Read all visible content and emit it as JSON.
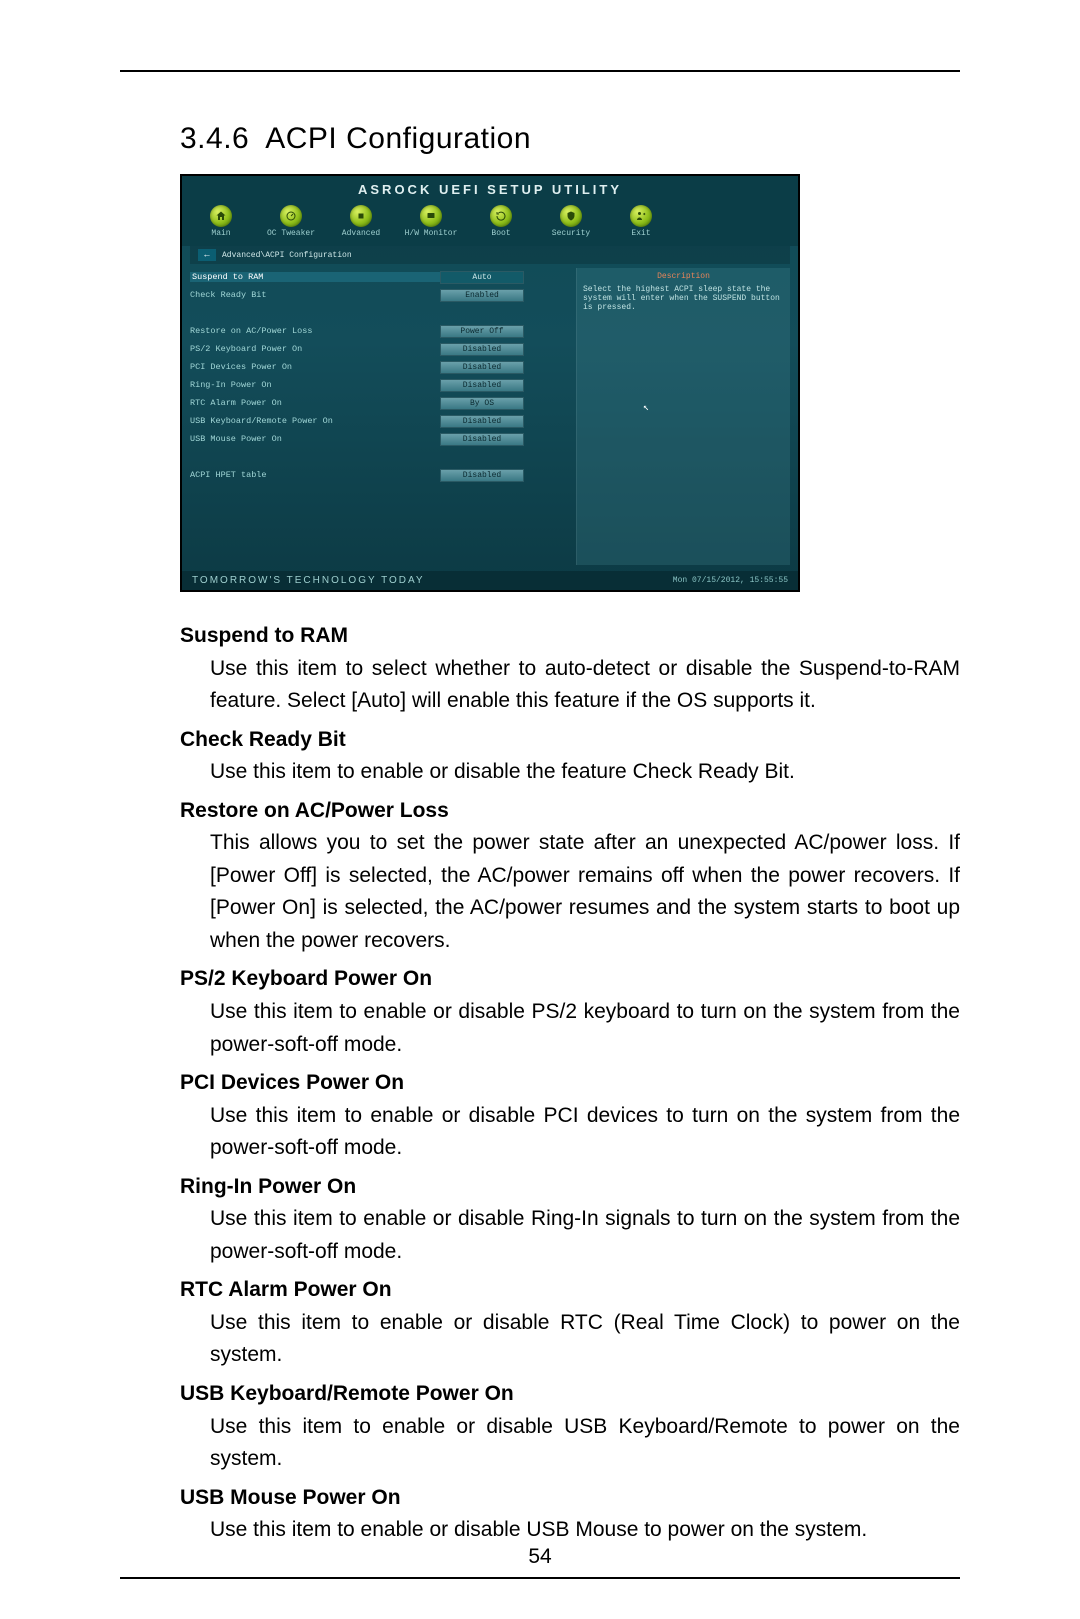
{
  "page_number": "54",
  "section": {
    "number": "3.4.6",
    "title": "ACPI Configuration"
  },
  "bios": {
    "window_title": "ASROCK UEFI SETUP UTILITY",
    "tabs": [
      {
        "id": "main",
        "label": "Main"
      },
      {
        "id": "oc",
        "label": "OC Tweaker"
      },
      {
        "id": "adv",
        "label": "Advanced"
      },
      {
        "id": "hw",
        "label": "H/W Monitor"
      },
      {
        "id": "boot",
        "label": "Boot"
      },
      {
        "id": "sec",
        "label": "Security"
      },
      {
        "id": "exit",
        "label": "Exit"
      }
    ],
    "breadcrumb": "Advanced\\ACPI Configuration",
    "options": [
      {
        "label": "Suspend to RAM",
        "value": "Auto",
        "selected": true
      },
      {
        "label": "Check Ready Bit",
        "value": "Enabled"
      },
      {
        "label": "",
        "value": ""
      },
      {
        "label": "Restore on AC/Power Loss",
        "value": "Power Off"
      },
      {
        "label": "PS/2 Keyboard Power On",
        "value": "Disabled"
      },
      {
        "label": "PCI Devices Power On",
        "value": "Disabled"
      },
      {
        "label": "Ring-In Power On",
        "value": "Disabled"
      },
      {
        "label": "RTC Alarm Power On",
        "value": "By OS"
      },
      {
        "label": "USB Keyboard/Remote Power On",
        "value": "Disabled"
      },
      {
        "label": "USB Mouse Power On",
        "value": "Disabled"
      },
      {
        "label": "",
        "value": ""
      },
      {
        "label": "ACPI HPET table",
        "value": "Disabled"
      }
    ],
    "help_header": "Description",
    "help_text": "Select the highest ACPI sleep state the system will enter when the SUSPEND button is pressed.",
    "footer_slogan": "TOMORROW'S TECHNOLOGY TODAY",
    "footer_datetime": "Mon 07/15/2012, 15:55:55"
  },
  "entries": [
    {
      "title": "Suspend to RAM",
      "body": "Use this item to select whether to auto-detect or disable the Suspend-to-RAM feature. Select [Auto] will enable this feature if the OS supports it."
    },
    {
      "title": "Check Ready Bit",
      "body": "Use this item to enable or disable the feature Check Ready Bit."
    },
    {
      "title": "Restore on AC/Power Loss",
      "body": "This allows you to set the power state after an unexpected AC/power loss. If [Power Off] is selected, the AC/power remains off when the power recovers. If [Power On] is selected, the AC/power resumes and the system starts to boot up when the power recovers."
    },
    {
      "title": "PS/2 Keyboard Power On",
      "body": "Use this item to enable or disable PS/2 keyboard to turn on the system from the power-soft-off mode."
    },
    {
      "title": "PCI Devices Power On",
      "body": "Use this item to enable or disable PCI devices to turn on the system from the power-soft-off mode."
    },
    {
      "title": "Ring-In Power On",
      "body": "Use this item to enable or disable Ring-In signals to turn on the system from the power-soft-off mode."
    },
    {
      "title": "RTC Alarm Power On",
      "body": "Use this item to enable or disable RTC (Real Time Clock) to power on the system."
    },
    {
      "title": "USB Keyboard/Remote Power On",
      "body": "Use this item to enable or disable USB Keyboard/Remote to power on the system."
    },
    {
      "title": "USB Mouse Power On",
      "body": "Use this item to enable or disable USB Mouse to power on the system."
    }
  ]
}
